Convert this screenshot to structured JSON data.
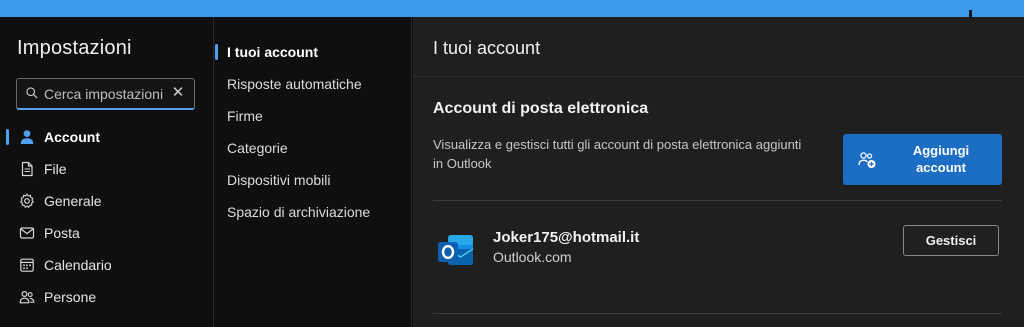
{
  "sidebar": {
    "title": "Impostazioni",
    "search": {
      "placeholder": "Cerca impostazioni",
      "clear_icon": "close-icon"
    },
    "items": [
      {
        "label": "Account",
        "icon": "person-icon",
        "active": true
      },
      {
        "label": "File",
        "icon": "document-icon"
      },
      {
        "label": "Generale",
        "icon": "gear-icon"
      },
      {
        "label": "Posta",
        "icon": "mail-icon"
      },
      {
        "label": "Calendario",
        "icon": "calendar-icon"
      },
      {
        "label": "Persone",
        "icon": "people-icon"
      }
    ]
  },
  "submenu": {
    "items": [
      {
        "label": "I tuoi account",
        "active": true
      },
      {
        "label": "Risposte automatiche"
      },
      {
        "label": "Firme"
      },
      {
        "label": "Categorie"
      },
      {
        "label": "Dispositivi mobili"
      },
      {
        "label": "Spazio di archiviazione"
      }
    ]
  },
  "main": {
    "title": "I tuoi account",
    "section": {
      "title": "Account di posta elettronica",
      "description": "Visualizza e gestisci tutti gli account di posta elettronica aggiunti in Outlook",
      "add_button": "Aggiungi account"
    },
    "account": {
      "email": "Joker175@hotmail.it",
      "type": "Outlook.com",
      "manage_button": "Gestisci"
    }
  },
  "colors": {
    "accent": "#4ea1f0",
    "primary_button": "#1c6ec4",
    "top_bar": "#3b9aeb"
  }
}
